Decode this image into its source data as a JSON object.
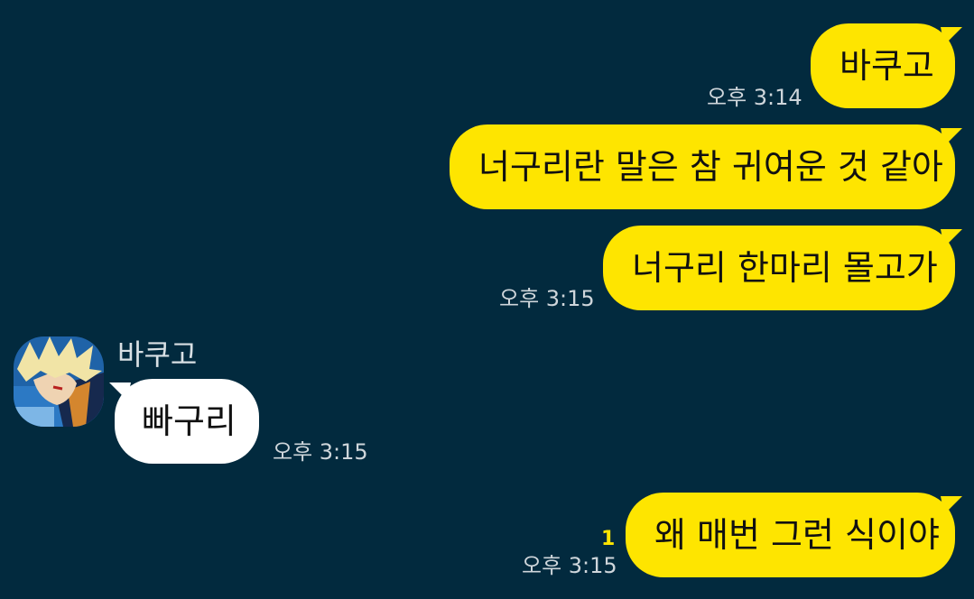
{
  "colors": {
    "background": "#022a3e",
    "outgoing_bubble": "#fee500",
    "incoming_bubble": "#ffffff",
    "time_text": "#cfd6db",
    "unread_count": "#fee500"
  },
  "messages": [
    {
      "direction": "outgoing",
      "text": "바쿠고",
      "time": "오후 3:14"
    },
    {
      "direction": "outgoing",
      "text": "너구리란 말은 참 귀여운 것 같아",
      "time": ""
    },
    {
      "direction": "outgoing",
      "text": "너구리 한마리 몰고가",
      "time": "오후 3:15"
    },
    {
      "direction": "incoming",
      "sender": "바쿠고",
      "avatar_icon": "profile-avatar-icon",
      "text": "빠구리",
      "time": "오후 3:15"
    },
    {
      "direction": "outgoing",
      "text": "왜 매번 그런 식이야",
      "time": "오후 3:15",
      "unread": "1"
    }
  ]
}
